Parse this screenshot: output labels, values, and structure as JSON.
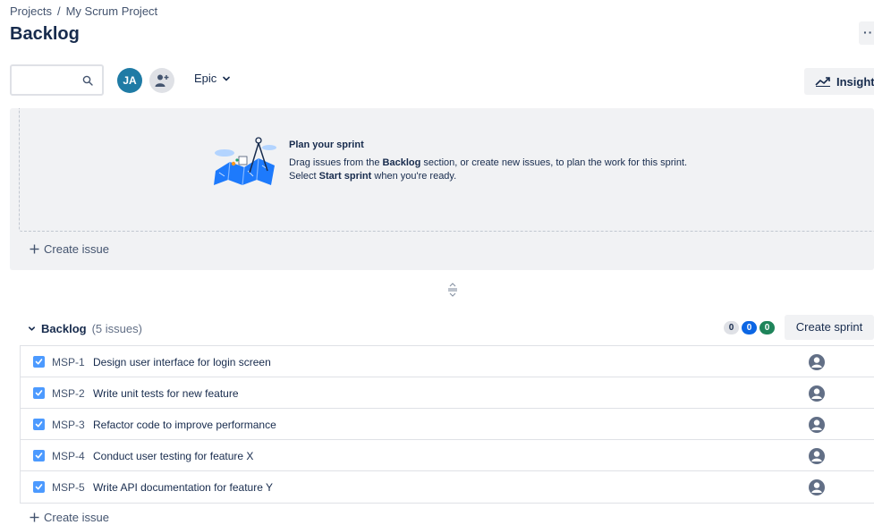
{
  "breadcrumb": {
    "projects": "Projects",
    "separator": "/",
    "project": "My Scrum Project"
  },
  "page": {
    "title": "Backlog",
    "more_label": "··"
  },
  "toolbar": {
    "search_placeholder": "",
    "avatar_initials": "JA",
    "epic_label": "Epic",
    "insights_label": "Insights"
  },
  "sprint": {
    "title": "Plan your sprint",
    "desc_1": "Drag issues from the ",
    "desc_bold_1": "Backlog",
    "desc_2": " section, or create new issues, to plan the work for this sprint. Select ",
    "desc_bold_2": "Start sprint",
    "desc_3": " when you're ready.",
    "create_issue": "Create issue"
  },
  "backlog": {
    "name": "Backlog",
    "count_label": "(5 issues)",
    "todo_count": "0",
    "in_progress_count": "0",
    "done_count": "0",
    "create_sprint": "Create sprint",
    "create_issue": "Create issue",
    "issues": [
      {
        "key": "MSP-1",
        "summary": "Design user interface for login screen"
      },
      {
        "key": "MSP-2",
        "summary": "Write unit tests for new feature"
      },
      {
        "key": "MSP-3",
        "summary": "Refactor code to improve performance"
      },
      {
        "key": "MSP-4",
        "summary": "Conduct user testing for feature X"
      },
      {
        "key": "MSP-5",
        "summary": "Write API documentation for feature Y"
      }
    ]
  },
  "colors": {
    "accent": "#0c66e4",
    "done": "#1f845a",
    "avatar": "#1f7ba5",
    "panel": "#f1f2f4"
  }
}
